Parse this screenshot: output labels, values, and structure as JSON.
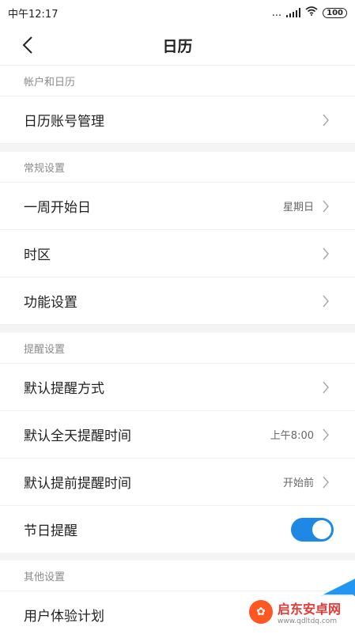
{
  "status": {
    "time": "中午12:17",
    "dots": "...",
    "battery": "100"
  },
  "header": {
    "title": "日历"
  },
  "sections": [
    {
      "header": "帐户和日历",
      "rows": [
        {
          "label": "日历账号管理",
          "value": ""
        }
      ]
    },
    {
      "header": "常规设置",
      "rows": [
        {
          "label": "一周开始日",
          "value": "星期日"
        },
        {
          "label": "时区",
          "value": ""
        },
        {
          "label": "功能设置",
          "value": ""
        }
      ]
    },
    {
      "header": "提醒设置",
      "rows": [
        {
          "label": "默认提醒方式",
          "value": ""
        },
        {
          "label": "默认全天提醒时间",
          "value": "上午8:00"
        },
        {
          "label": "默认提前提醒时间",
          "value": "开始前"
        },
        {
          "label": "节日提醒",
          "toggle": true
        }
      ]
    },
    {
      "header": "其他设置",
      "rows": [
        {
          "label": "用户体验计划",
          "value": ""
        }
      ]
    }
  ],
  "watermark": {
    "name": "启东安卓网",
    "url": "www.qdltdq.com"
  },
  "colors": {
    "accent": "#1e88e5",
    "section_bg": "#f4f4f4"
  }
}
